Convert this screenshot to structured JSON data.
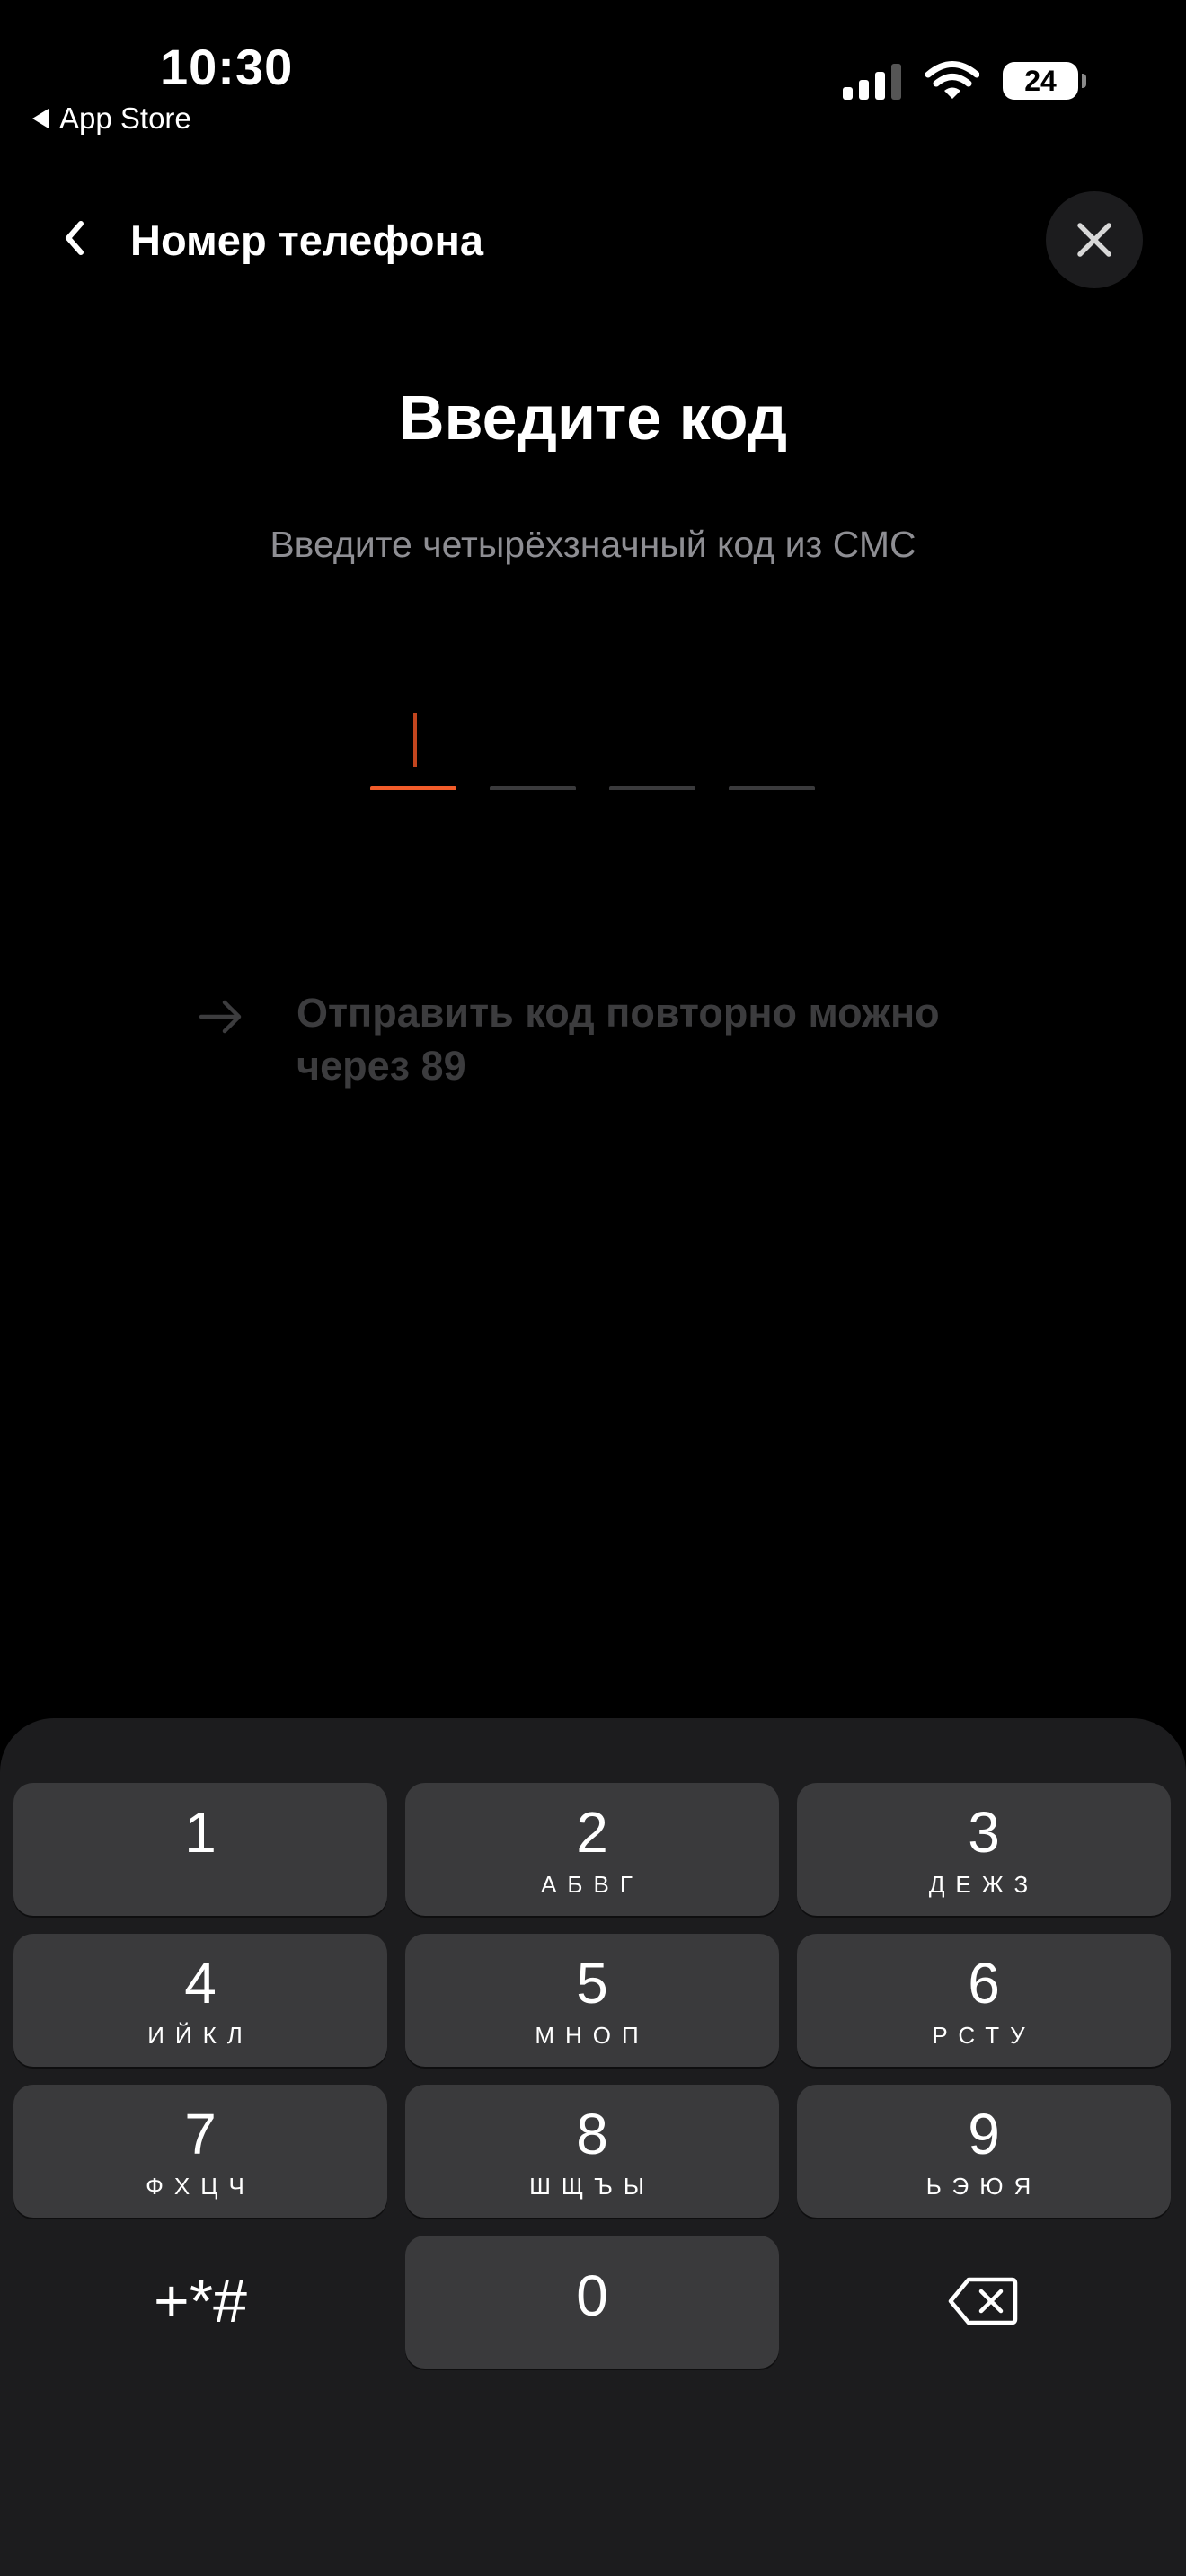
{
  "status_bar": {
    "time": "10:30",
    "back_app": "App Store",
    "battery": "24"
  },
  "header": {
    "title": "Номер телефона"
  },
  "content": {
    "heading": "Введите код",
    "subtext": "Введите четырёхзначный код из СМС",
    "code_length": 4,
    "active_slot": 1,
    "resend_text": "Отправить код повторно можно через 89"
  },
  "keypad": {
    "keys": [
      {
        "digit": "1",
        "letters": ""
      },
      {
        "digit": "2",
        "letters": "АБВГ"
      },
      {
        "digit": "3",
        "letters": "ДЕЖЗ"
      },
      {
        "digit": "4",
        "letters": "ИЙКЛ"
      },
      {
        "digit": "5",
        "letters": "МНОП"
      },
      {
        "digit": "6",
        "letters": "РСТУ"
      },
      {
        "digit": "7",
        "letters": "ФХЦЧ"
      },
      {
        "digit": "8",
        "letters": "ШЩЪЫ"
      },
      {
        "digit": "9",
        "letters": "ЬЭЮЯ"
      },
      {
        "digit": "+*#",
        "letters": ""
      },
      {
        "digit": "0",
        "letters": ""
      }
    ]
  },
  "colors": {
    "background": "#000000",
    "accent": "#f25c2a",
    "key_bg": "#3a3a3c",
    "keypad_bg": "#1c1c1e"
  },
  "icons": [
    "chevron-left-icon",
    "close-icon",
    "arrow-right-icon",
    "backspace-icon",
    "cellular-signal-icon",
    "wifi-icon",
    "battery-icon"
  ]
}
